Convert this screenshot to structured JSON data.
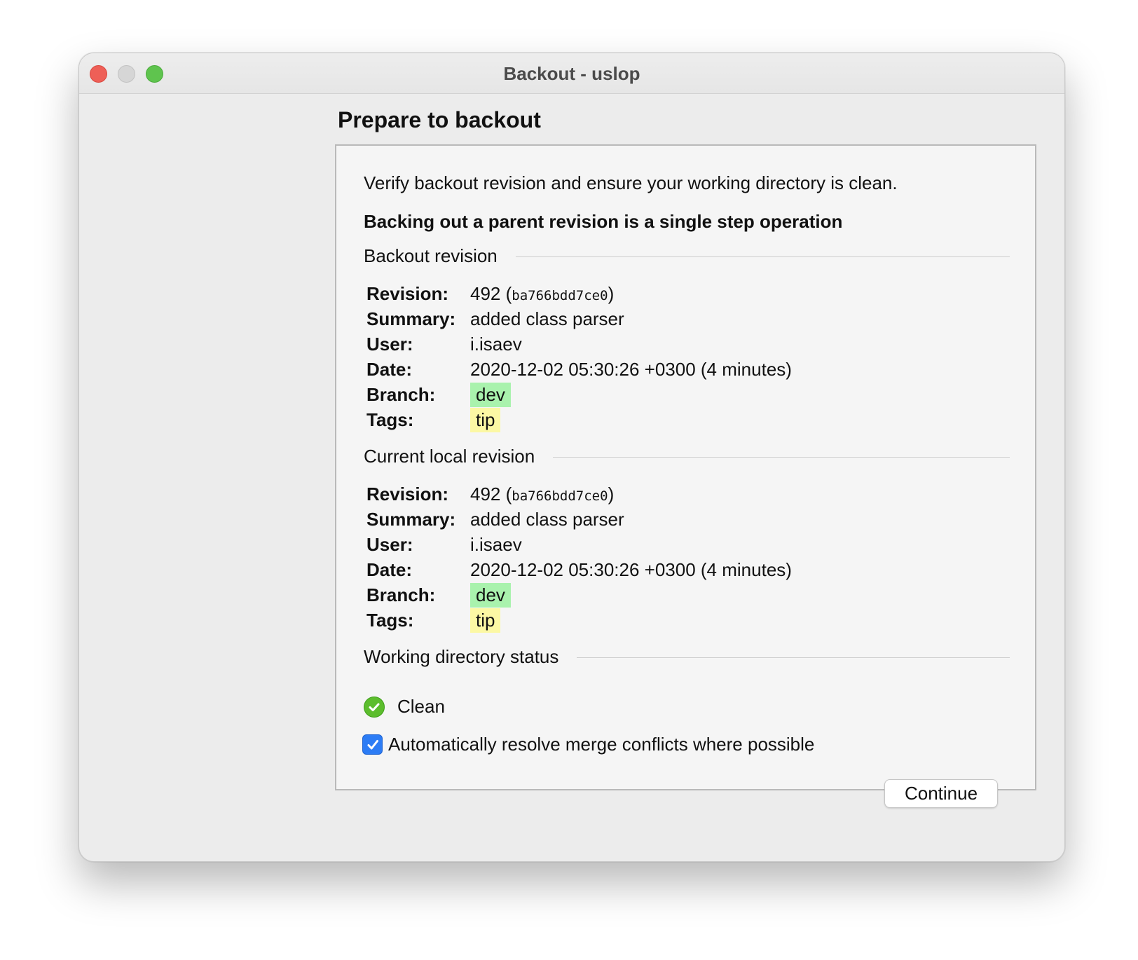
{
  "window": {
    "title": "Backout - uslop"
  },
  "page_title": "Prepare to backout",
  "intro_text": "Verify backout revision and ensure your working directory is clean.",
  "operation_note": "Backing out a parent revision is a single step operation",
  "backout_revision": {
    "group_title": "Backout revision",
    "labels": {
      "revision": "Revision:",
      "summary": "Summary:",
      "user": "User:",
      "date": "Date:",
      "branch": "Branch:",
      "tags": "Tags:"
    },
    "revision_number": "492",
    "revision_hash": "ba766bdd7ce0",
    "summary": "added class parser",
    "user": "i.isaev",
    "date": "2020-12-02 05:30:26 +0300 (4 minutes)",
    "branch": "dev",
    "tags": "tip"
  },
  "current_revision": {
    "group_title": "Current local revision",
    "labels": {
      "revision": "Revision:",
      "summary": "Summary:",
      "user": "User:",
      "date": "Date:",
      "branch": "Branch:",
      "tags": "Tags:"
    },
    "revision_number": "492",
    "revision_hash": "ba766bdd7ce0",
    "summary": "added class parser",
    "user": "i.isaev",
    "date": "2020-12-02 05:30:26 +0300 (4 minutes)",
    "branch": "dev",
    "tags": "tip"
  },
  "working_directory": {
    "group_title": "Working directory status",
    "status_text": "Clean",
    "status_icon": "check-circle-icon"
  },
  "auto_resolve": {
    "label": "Automatically resolve merge conflicts where possible",
    "checked": true
  },
  "continue_label": "Continue",
  "colors": {
    "branch_highlight": "#a9f2ad",
    "tag_highlight": "#fcf8a4",
    "checkbox_accent": "#2c7cf5",
    "status_ok": "#5cbd2d"
  }
}
